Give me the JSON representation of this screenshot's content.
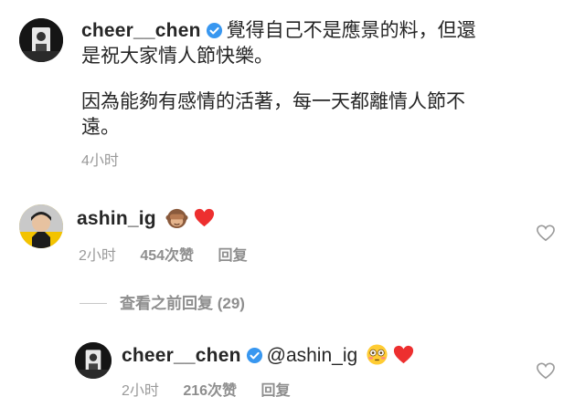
{
  "post": {
    "author": "cheer__chen",
    "caption_lines": [
      "覺得自己不是應景的料，但還",
      "是祝大家情人節快樂。",
      "因為能夠有感情的活著，每一天都離情人節不",
      "遠。"
    ],
    "time": "4小时"
  },
  "comment": {
    "author": "ashin_ig",
    "emojis": [
      "see-no-evil-monkey",
      "red-heart"
    ],
    "time": "2小时",
    "likes": "454次赞",
    "reply_label": "回复"
  },
  "view_replies": {
    "label": "查看之前回复 (29)"
  },
  "reply": {
    "author": "cheer__chen",
    "mention": "@ashin_ig",
    "emojis": [
      "flushed-face",
      "red-heart"
    ],
    "time": "2小时",
    "likes": "216次赞",
    "reply_label": "回复"
  },
  "colors": {
    "text": "#262626",
    "secondary": "#9a9a9a",
    "verified_blue": "#3897f0",
    "heart_red": "#ed4956"
  }
}
